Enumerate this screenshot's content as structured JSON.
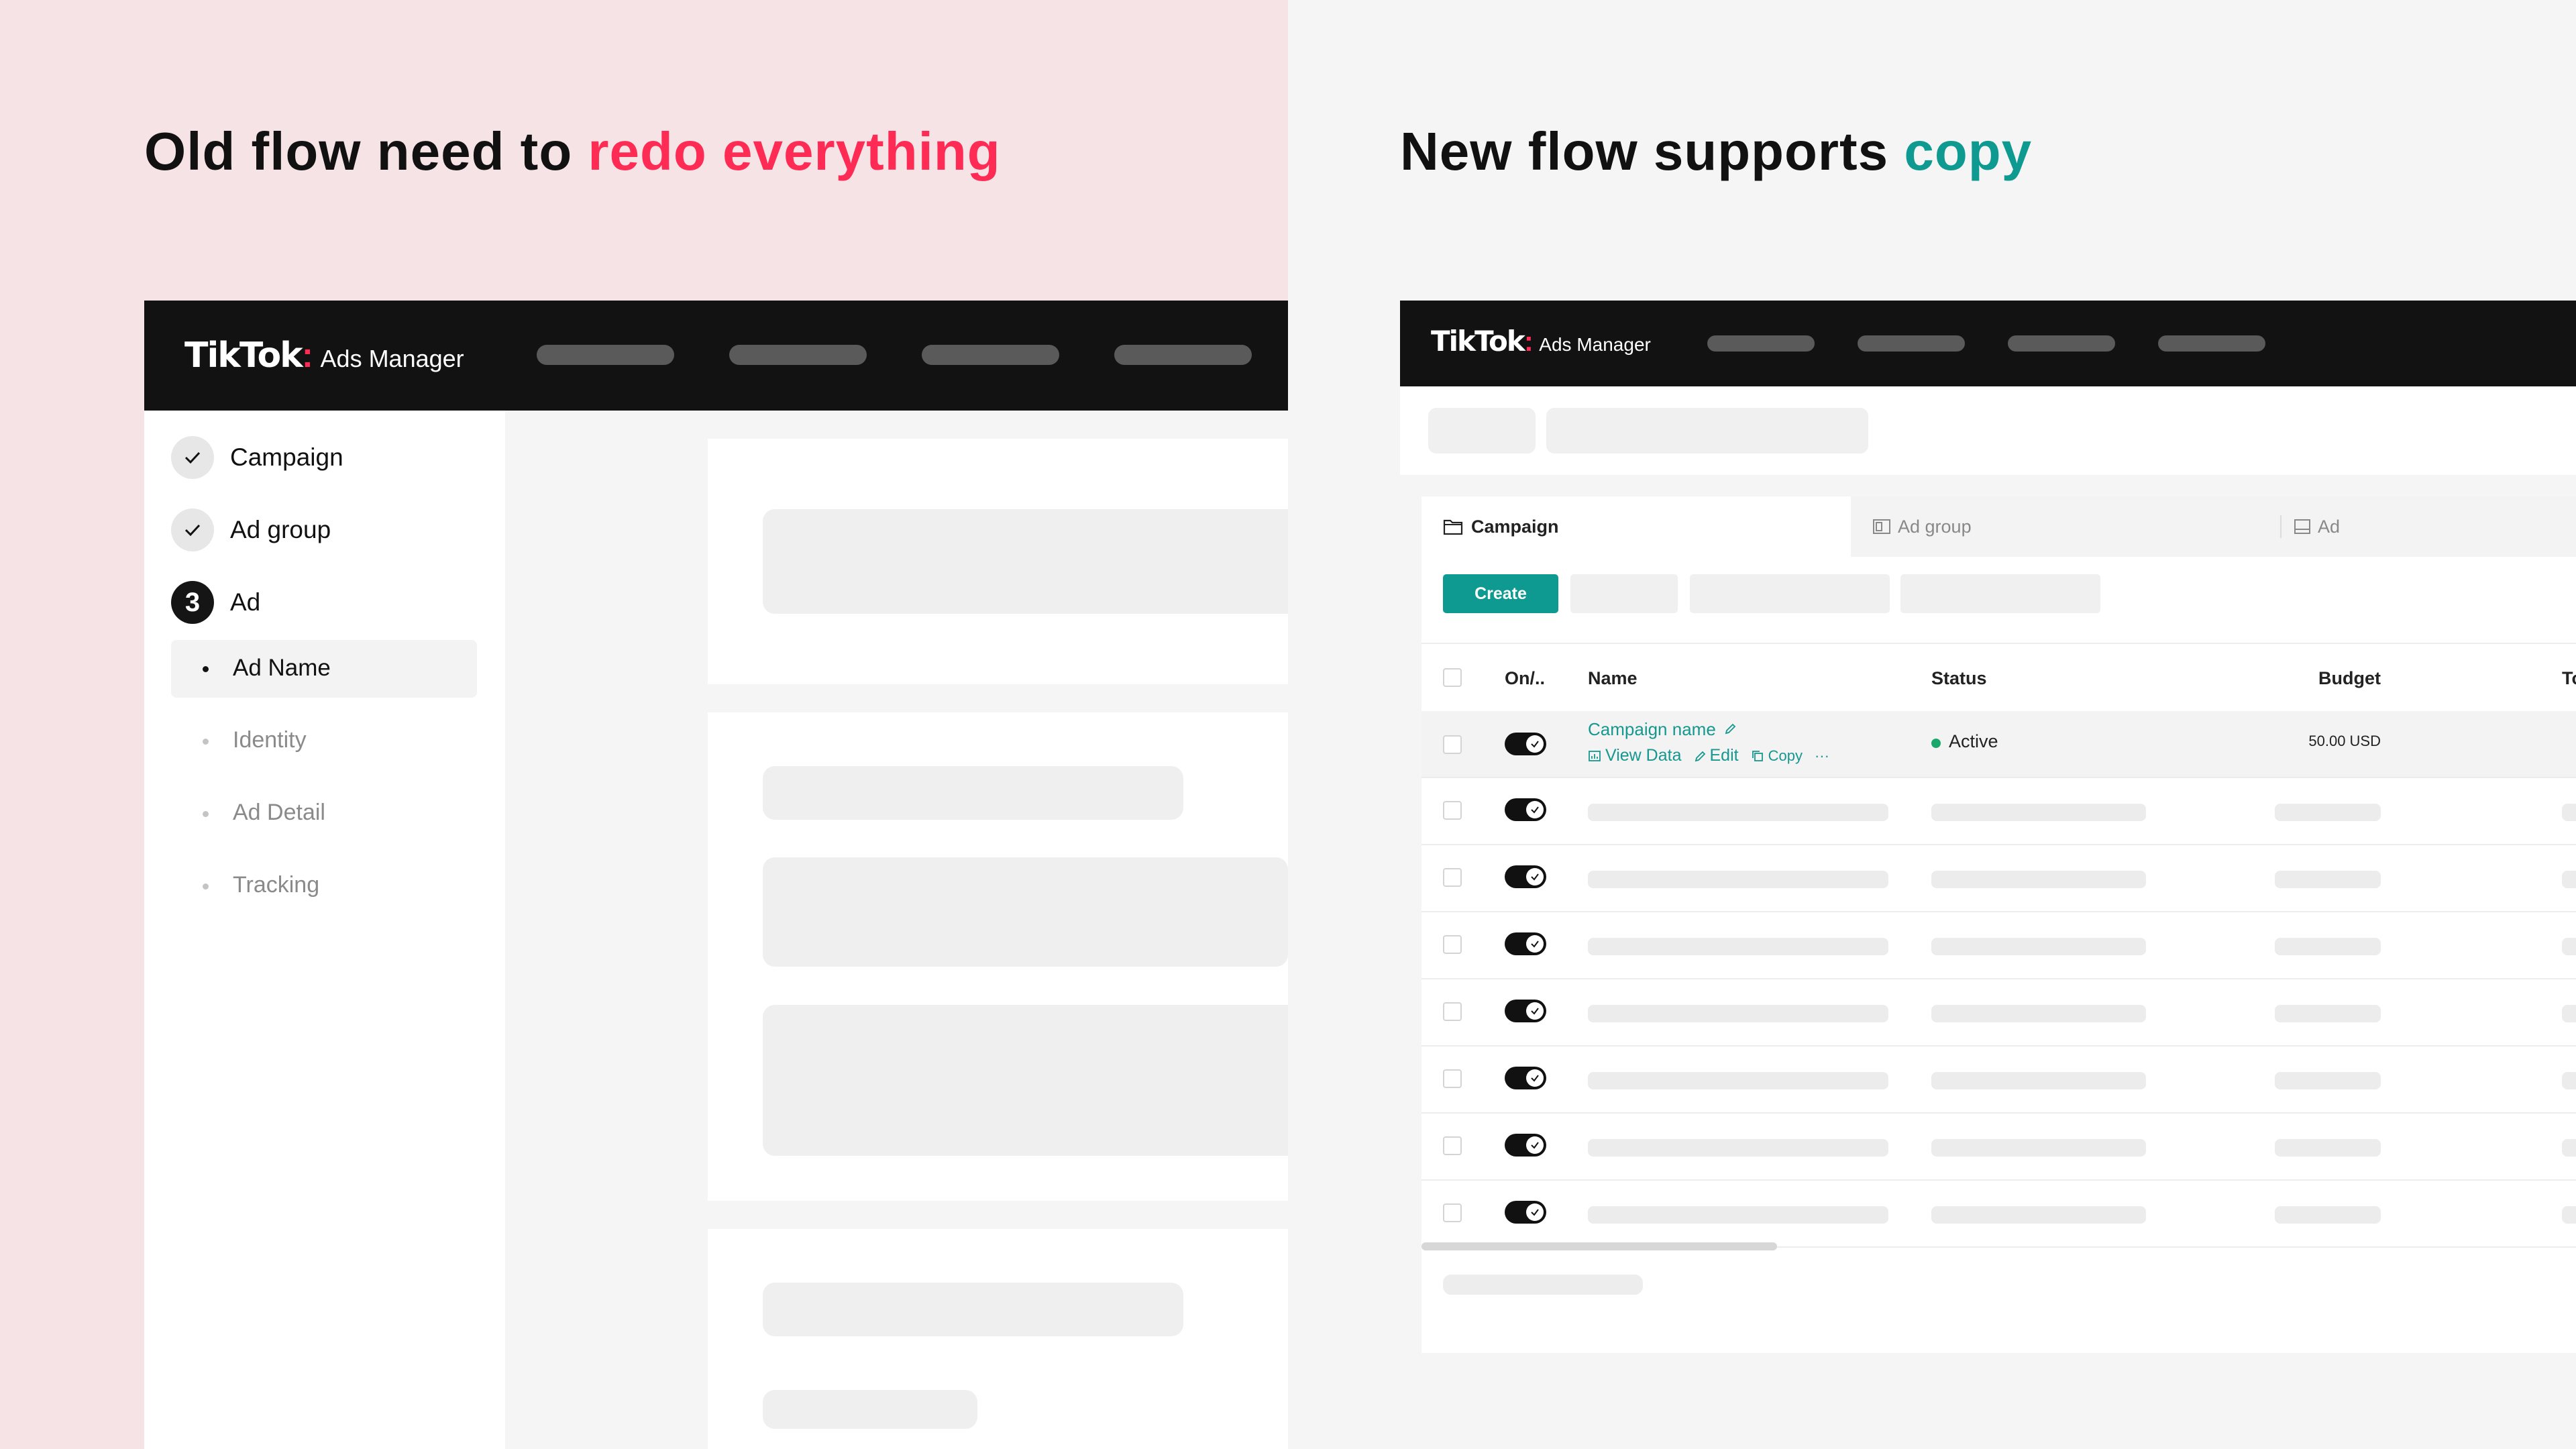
{
  "left": {
    "heading_pre": "Old flow need to ",
    "heading_hl": "redo everything",
    "heading_hl_color": "#fe2c55",
    "topbar": {
      "logo_brand": "TikTok",
      "logo_colon": ":",
      "logo_product": "Ads Manager"
    },
    "steps": [
      {
        "label": "Campaign",
        "state": "done"
      },
      {
        "label": "Ad group",
        "state": "done"
      },
      {
        "label": "Ad",
        "state": "current",
        "number": "3"
      }
    ],
    "substeps": [
      {
        "label": "Ad Name",
        "active": true
      },
      {
        "label": "Identity",
        "active": false
      },
      {
        "label": "Ad Detail",
        "active": false
      },
      {
        "label": "Tracking",
        "active": false
      }
    ]
  },
  "right": {
    "heading_pre": "New flow supports ",
    "heading_hl": "copy",
    "heading_hl_color": "#0e9a90",
    "topbar": {
      "logo_brand": "TikTok",
      "logo_colon": ":",
      "logo_product": "Ads Manager"
    },
    "tabs": [
      {
        "label": "Campaign",
        "icon": "folder-icon",
        "active": true
      },
      {
        "label": "Ad group",
        "icon": "adgroup-icon",
        "active": false
      },
      {
        "label": "Ad",
        "icon": "ad-icon",
        "active": false
      }
    ],
    "create_label": "Create",
    "accent_color": "#0e9a90",
    "table": {
      "headers": {
        "onoff": "On/..",
        "name": "Name",
        "status": "Status",
        "budget": "Budget",
        "more": "To"
      },
      "first_row": {
        "name": "Campaign name",
        "actions": {
          "view": "View Data",
          "edit": "Edit",
          "copy": "Copy",
          "more": "···"
        },
        "status": "Active",
        "budget": "50.00 USD"
      }
    }
  }
}
